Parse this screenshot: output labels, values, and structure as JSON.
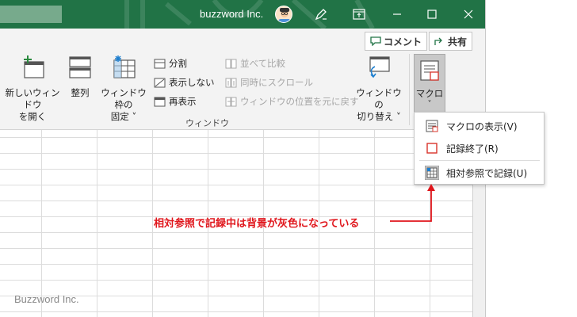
{
  "titlebar": {
    "user_name": "buzzword Inc."
  },
  "ribbon": {
    "comment_label": "コメント",
    "share_label": "共有",
    "buttons": {
      "new_window": [
        "新しいウィンドウ",
        "を開く"
      ],
      "arrange": "整列",
      "freeze": [
        "ウィンドウ枠の",
        "固定 ˅"
      ],
      "split": "分割",
      "hide": "表示しない",
      "unhide": "再表示",
      "side_by_side": "並べて比較",
      "sync_scroll": "同時にスクロール",
      "reset_position": "ウィンドウの位置を元に戻す",
      "switch_window": [
        "ウィンドウの",
        "切り替え ˅"
      ],
      "macro": "マクロ",
      "macro_caret": "˅"
    },
    "group_label": "ウィンドウ"
  },
  "menu": {
    "items": [
      {
        "label": "マクロの表示(V)"
      },
      {
        "label": "記録終了(R)"
      },
      {
        "label": "相対参照で記録(U)"
      }
    ]
  },
  "annotation": {
    "text": "相対参照で記録中は背景が灰色になっている"
  },
  "brand": {
    "text": "Buzzword Inc."
  },
  "colors": {
    "titlebar": "#217346",
    "annotation": "#e0161c",
    "macro_active_bg": "#c8c8c8"
  }
}
